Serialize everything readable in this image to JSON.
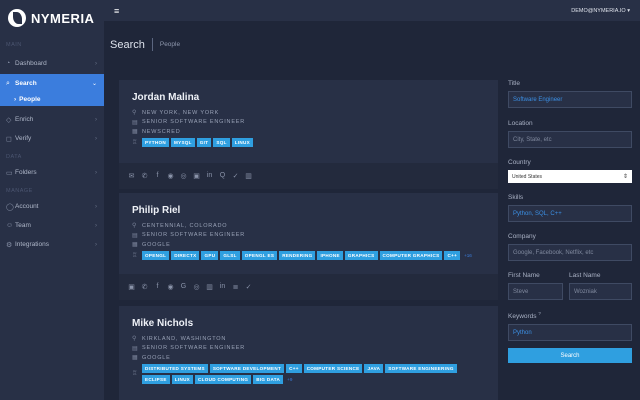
{
  "app": {
    "name": "NYMERIA"
  },
  "sidebar": {
    "sections": [
      "MAIN",
      "DATA",
      "MANAGE"
    ],
    "items": [
      {
        "label": "Dashboard",
        "icon": "dashboard-icon"
      },
      {
        "label": "Search",
        "icon": "search-icon"
      },
      {
        "label": "People",
        "icon": ""
      },
      {
        "label": "Enrich",
        "icon": "enrich-icon"
      },
      {
        "label": "Verify",
        "icon": "verify-icon"
      },
      {
        "label": "Folders",
        "icon": "folder-icon"
      },
      {
        "label": "Account",
        "icon": "account-icon"
      },
      {
        "label": "Team",
        "icon": "team-icon"
      },
      {
        "label": "Integrations",
        "icon": "integrations-icon"
      }
    ]
  },
  "topbar": {
    "user": "DEMO@NYMERIA.IO ▾"
  },
  "breadcrumb": {
    "title": "Search",
    "page": "People"
  },
  "results": [
    {
      "name": "Jordan Malina",
      "location": "New York, New York",
      "title": "Senior Software Engineer",
      "company": "Newscred",
      "skills": [
        "PYTHON",
        "MYSQL",
        "GIT",
        "SQL",
        "LINUX"
      ],
      "more": ""
    },
    {
      "name": "Philip Riel",
      "location": "Centennial, Colorado",
      "title": "Senior Software Engineer",
      "company": "Google",
      "skills": [
        "OPENGL",
        "DIRECTX",
        "GPU",
        "GLSL",
        "OPENGL ES",
        "RENDERING",
        "IPHONE",
        "GRAPHICS",
        "COMPUTER GRAPHICS",
        "C++"
      ],
      "more": "+16"
    },
    {
      "name": "Mike Nichols",
      "location": "Kirkland, Washington",
      "title": "Senior Software Engineer",
      "company": "Google",
      "skills": [
        "DISTRIBUTED SYSTEMS",
        "SOFTWARE DEVELOPMENT",
        "C++",
        "COMPUTER SCIENCE",
        "JAVA",
        "SOFTWARE ENGINEERING",
        "ECLIPSE",
        "LINUX",
        "CLOUD COMPUTING",
        "BIG DATA"
      ],
      "more": "+9"
    }
  ],
  "filters": {
    "title_label": "Title",
    "title_value": "Software Engineer",
    "location_label": "Location",
    "location_placeholder": "City, State, etc",
    "country_label": "Country",
    "country_value": "United States",
    "skills_label": "Skills",
    "skills_value": "Python, SQL, C++",
    "company_label": "Company",
    "company_placeholder": "Google, Facebook, Netflix, etc",
    "first_label": "First Name",
    "first_placeholder": "Steve",
    "last_label": "Last Name",
    "last_placeholder": "Wozniak",
    "keywords_label": "Keywords",
    "keywords_sup": "?",
    "keywords_value": "Python",
    "search_button": "Search"
  }
}
